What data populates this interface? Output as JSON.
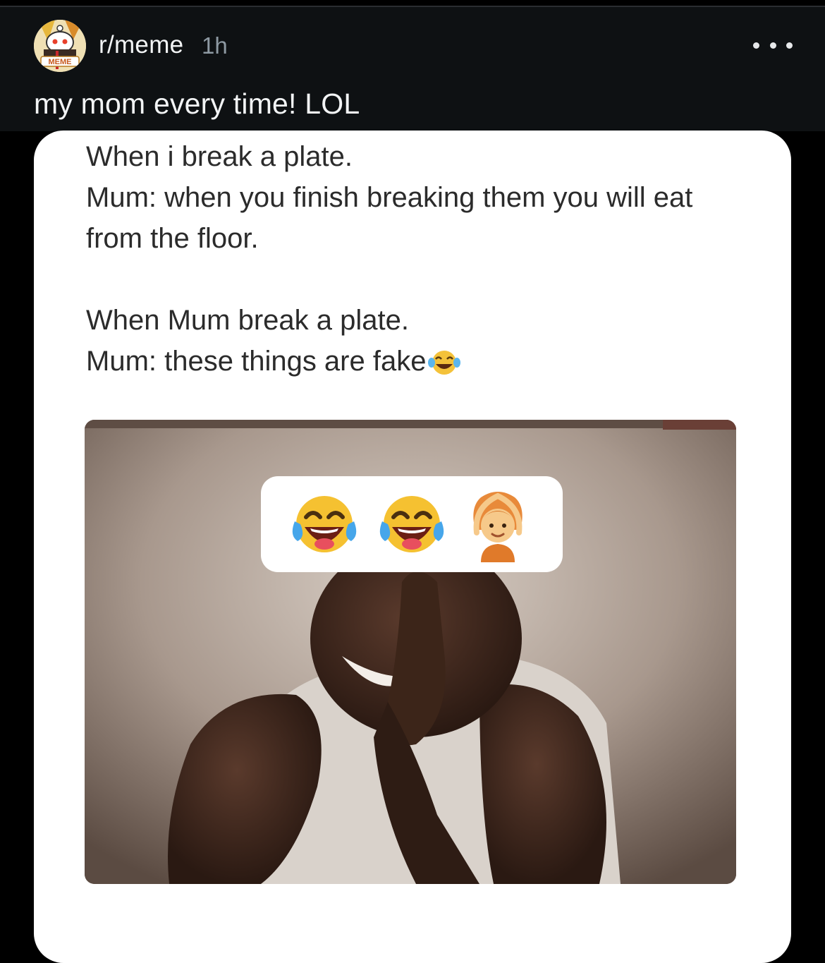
{
  "post": {
    "subreddit": "r/meme",
    "age": "1h",
    "title": "my mom every time! LOL",
    "avatar_badge": "MEME"
  },
  "meme": {
    "lines_top": [
      "When i break a plate.",
      "Mum: when you finish breaking them you will eat",
      "from the floor."
    ],
    "lines_bottom": [
      "When Mum break a plate.",
      "Mum: these things are fake"
    ],
    "emoji_row": [
      "tears-of-joy-icon",
      "tears-of-joy-icon",
      "person-gesturing-ok-icon"
    ]
  },
  "colors": {
    "background": "#000000",
    "header": "#0e1113",
    "text_primary": "#f2f4f5",
    "text_muted": "#8e9aa3",
    "card": "#ffffff",
    "meme_text": "#2b2b2b"
  },
  "icons": {
    "more": "more-options-icon",
    "avatar": "subreddit-avatar-icon"
  }
}
